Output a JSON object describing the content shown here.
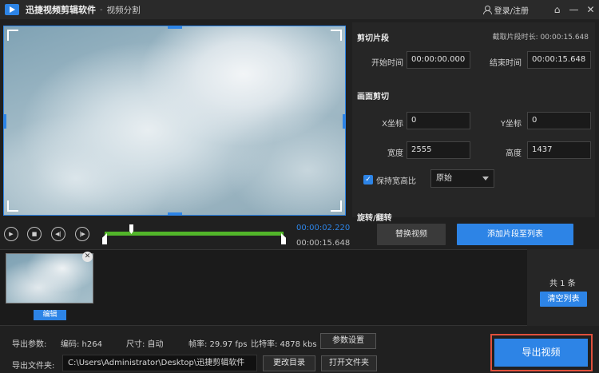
{
  "window": {
    "app_title": "迅捷视频剪辑软件",
    "separator": "-",
    "subtitle": "视频分割",
    "login": "登录/注册",
    "home_icon": "home-icon",
    "min_icon": "minimize-icon",
    "close_icon": "close-icon"
  },
  "player": {
    "current_time": "00:00:02.220",
    "total_time": "00:00:15.648",
    "trim_start_fraction": 0.0,
    "trim_end_fraction": 1.0,
    "playhead_fraction": 0.14
  },
  "clip_panel": {
    "title": "剪切片段",
    "duration_label": "截取片段时长",
    "duration_value": "00:00:15.648",
    "start_label": "开始时间",
    "start_value": "00:00:00.000",
    "end_label": "结束时间",
    "end_value": "00:00:15.648"
  },
  "crop_panel": {
    "title": "画面剪切",
    "x_label": "X坐标",
    "x_value": "0",
    "y_label": "Y坐标",
    "y_value": "0",
    "width_label": "宽度",
    "width_value": "2555",
    "height_label": "高度",
    "height_value": "1437",
    "keep_ratio_label": "保持宽高比",
    "keep_ratio_checked": true,
    "ratio_selected": "原始"
  },
  "rotate_panel": {
    "title": "旋转/翻转"
  },
  "actions": {
    "replace_video": "替换视频",
    "add_segment": "添加片段至列表"
  },
  "clip_list": {
    "thumb_tag": "编辑",
    "count": "共 1 条",
    "clear": "清空列表"
  },
  "export": {
    "params_label": "导出参数:",
    "codec": "编码: h264",
    "size": "尺寸: 自动",
    "fps": "帧率: 29.97 fps",
    "bitrate": "比特率: 4878 kbs",
    "settings_button": "参数设置",
    "folder_label": "导出文件夹:",
    "folder_path": "C:\\Users\\Administrator\\Desktop\\迅捷剪辑软件",
    "change_dir": "更改目录",
    "open_folder": "打开文件夹",
    "export_button": "导出视频"
  },
  "colors": {
    "accent": "#2d84e6",
    "progress": "#52b52a",
    "highlight_frame": "#e0503c"
  }
}
